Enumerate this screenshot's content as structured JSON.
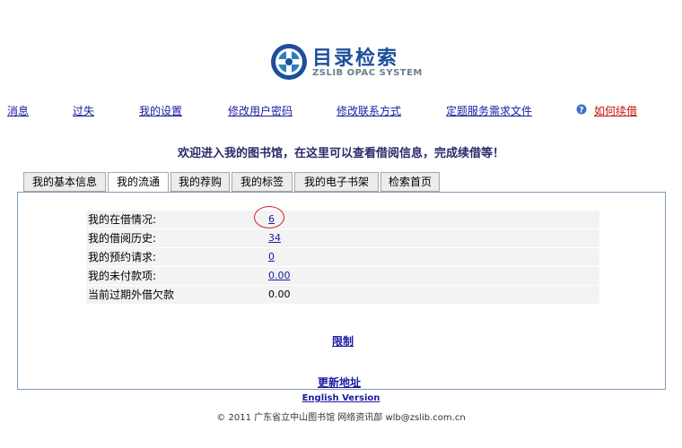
{
  "logo": {
    "title": "目录检索",
    "subtitle": "ZSLIB OPAC SYSTEM"
  },
  "nav": {
    "items": [
      "消息",
      "过失",
      "我的设置",
      "修改用户密码",
      "修改联系方式",
      "定题服务需求文件",
      "如何续借"
    ]
  },
  "welcome": "欢迎进入我的图书馆，在这里可以查看借阅信息，完成续借等！",
  "tabs": [
    "我的基本信息",
    "我的流通",
    "我的荐购",
    "我的标签",
    "我的电子书架",
    "检索首页"
  ],
  "active_tab": "我的流通",
  "stats": [
    {
      "label": "我的在借情况:",
      "value": "6"
    },
    {
      "label": "我的借阅历史:",
      "value": "34"
    },
    {
      "label": "我的预约请求:",
      "value": "0"
    },
    {
      "label": "我的未付款项:",
      "value": "0.00"
    },
    {
      "label": "当前过期外借欠款",
      "value": "0.00"
    }
  ],
  "links": {
    "limit": "限制",
    "update_address": "更新地址"
  },
  "footer": {
    "english": "English Version",
    "copyright": "© 2011 广东省立中山图书馆 网络资讯部 wlb@zslib.com.cn"
  },
  "colors": {
    "brand": "#1c4f9c",
    "link": "#1a1aa0",
    "panel_border": "#7f9db9",
    "highlight_circle": "#d41f1f"
  }
}
